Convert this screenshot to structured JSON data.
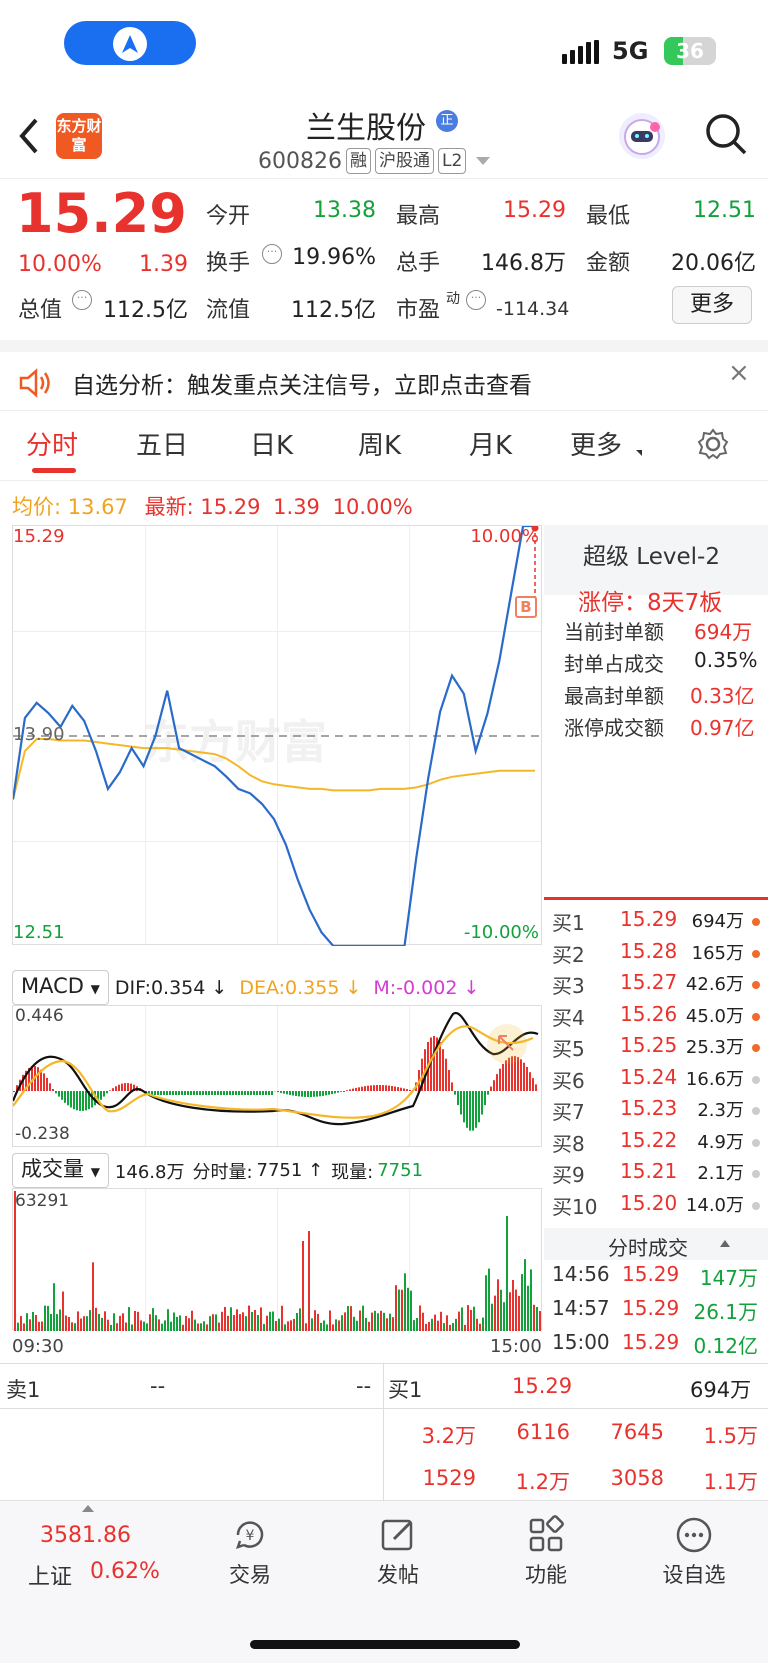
{
  "status_bar": {
    "network": "5G",
    "battery": "36",
    "battery_level": 0.36
  },
  "header": {
    "back_icon": "chevron-left-icon",
    "logo_text": "东方财富",
    "stock_name": "兰生股份",
    "badge": "正",
    "code": "600826",
    "tags": [
      "融",
      "沪股通",
      "L2"
    ],
    "search_icon": "search-icon"
  },
  "quote": {
    "price": "15.29",
    "change_pct": "10.00%",
    "change": "1.39",
    "open_label": "今开",
    "open": "13.38",
    "high_label": "最高",
    "high": "15.29",
    "low_label": "最低",
    "low": "12.51",
    "turnover_label": "换手",
    "turnover": "19.96%",
    "volume_label": "总手",
    "volume": "146.8万",
    "amount_label": "金额",
    "amount": "20.06亿",
    "mktcap_label": "总值",
    "mktcap": "112.5亿",
    "float_label": "流值",
    "float": "112.5亿",
    "pe_label": "市盈",
    "pe_sup": "动",
    "pe": "-114.34",
    "more_label": "更多"
  },
  "notice": {
    "text": "自选分析：触发重点关注信号，立即点击查看"
  },
  "tabs": [
    {
      "label": "分时",
      "active": true
    },
    {
      "label": "五日"
    },
    {
      "label": "日K"
    },
    {
      "label": "周K"
    },
    {
      "label": "月K"
    },
    {
      "label": "更多"
    }
  ],
  "summary": {
    "avg_label": "均价:",
    "avg": "13.67",
    "last_label": "最新:",
    "last": "15.29",
    "change": "1.39",
    "pct": "10.00%"
  },
  "chart": {
    "top_price": "15.29",
    "mid_price": "13.90",
    "bottom_price": "12.51",
    "top_pct": "10.00%",
    "bottom_pct": "-10.00%",
    "marker": "B",
    "watermark": "东方财富",
    "time_start": "09:30",
    "time_end": "15:00"
  },
  "chart_data": {
    "type": "line",
    "ylim": [
      12.51,
      15.29
    ],
    "series": [
      {
        "name": "price",
        "values": [
          13.48,
          14.02,
          14.12,
          14.05,
          13.96,
          14.1,
          14.0,
          13.8,
          13.55,
          13.66,
          13.82,
          13.7,
          13.9,
          14.2,
          13.82,
          13.78,
          13.74,
          13.7,
          13.63,
          13.55,
          13.52,
          13.45,
          13.35,
          13.18,
          12.95,
          12.75,
          12.6,
          12.51,
          12.51,
          12.51,
          12.51,
          12.51,
          12.51,
          12.51,
          13.1,
          13.62,
          14.06,
          14.3,
          14.18,
          13.8,
          14.05,
          14.4,
          14.85,
          15.29,
          15.29
        ]
      },
      {
        "name": "avg",
        "values": [
          13.48,
          13.8,
          13.88,
          13.88,
          13.87,
          13.87,
          13.87,
          13.86,
          13.85,
          13.84,
          13.83,
          13.82,
          13.82,
          13.82,
          13.81,
          13.8,
          13.79,
          13.78,
          13.75,
          13.7,
          13.64,
          13.6,
          13.58,
          13.57,
          13.56,
          13.55,
          13.55,
          13.54,
          13.54,
          13.54,
          13.54,
          13.55,
          13.55,
          13.55,
          13.56,
          13.58,
          13.61,
          13.63,
          13.64,
          13.65,
          13.66,
          13.67,
          13.67,
          13.67,
          13.67
        ]
      }
    ]
  },
  "side_panel": {
    "title": "超级 Level-2",
    "limit_title": "涨停：8天7板",
    "stats": [
      {
        "label": "当前封单额",
        "value": "694万",
        "color": "red"
      },
      {
        "label": "封单占成交",
        "value": "0.35%",
        "color": "dark"
      },
      {
        "label": "最高封单额",
        "value": "0.33亿",
        "color": "red"
      },
      {
        "label": "涨停成交额",
        "value": "0.97亿",
        "color": "red"
      }
    ]
  },
  "bids": [
    {
      "label": "买1",
      "price": "15.29",
      "vol": "694万",
      "dot": "orange"
    },
    {
      "label": "买2",
      "price": "15.28",
      "vol": "165万",
      "dot": "orange"
    },
    {
      "label": "买3",
      "price": "15.27",
      "vol": "42.6万",
      "dot": "orange"
    },
    {
      "label": "买4",
      "price": "15.26",
      "vol": "45.0万",
      "dot": "orange"
    },
    {
      "label": "买5",
      "price": "15.25",
      "vol": "25.3万",
      "dot": "orange"
    },
    {
      "label": "买6",
      "price": "15.24",
      "vol": "16.6万",
      "dot": "gray"
    },
    {
      "label": "买7",
      "price": "15.23",
      "vol": "2.3万",
      "dot": "gray"
    },
    {
      "label": "买8",
      "price": "15.22",
      "vol": "4.9万",
      "dot": "gray"
    },
    {
      "label": "买9",
      "price": "15.21",
      "vol": "2.1万",
      "dot": "gray"
    },
    {
      "label": "买10",
      "price": "15.20",
      "vol": "14.0万",
      "dot": "gray"
    }
  ],
  "ticks_title": "分时成交",
  "ticks": [
    {
      "time": "14:56",
      "price": "15.29",
      "vol": "147万"
    },
    {
      "time": "14:57",
      "price": "15.29",
      "vol": "26.1万"
    },
    {
      "time": "15:00",
      "price": "15.29",
      "vol": "0.12亿"
    }
  ],
  "macd": {
    "label": "MACD",
    "dif": "DIF:0.354 ↓",
    "dea": "DEA:0.355 ↓",
    "m": "M:-0.002 ↓",
    "top": "0.446",
    "bottom": "-0.238"
  },
  "volume": {
    "label": "成交量",
    "total": "146.8万",
    "fen_label": "分时量:",
    "fen": "7751 ↑",
    "now_label": "现量:",
    "now": "7751",
    "max": "63291"
  },
  "orderbook_bottom": {
    "sell_label": "卖1",
    "sell_price": "--",
    "sell_vol": "--",
    "buy_label": "买1",
    "buy_price": "15.29",
    "buy_vol": "694万",
    "row1": [
      "3.2万",
      "6116",
      "7645",
      "1.5万"
    ],
    "row2": [
      "1529",
      "1.2万",
      "3058",
      "1.1万"
    ]
  },
  "bottom_bar": {
    "index_value": "3581.86",
    "index_name": "上证",
    "index_pct": "0.62%",
    "items": [
      {
        "label": "交易",
        "icon": "trade-icon"
      },
      {
        "label": "发帖",
        "icon": "post-icon"
      },
      {
        "label": "功能",
        "icon": "grid-icon"
      },
      {
        "label": "设自选",
        "icon": "more-icon"
      }
    ]
  }
}
